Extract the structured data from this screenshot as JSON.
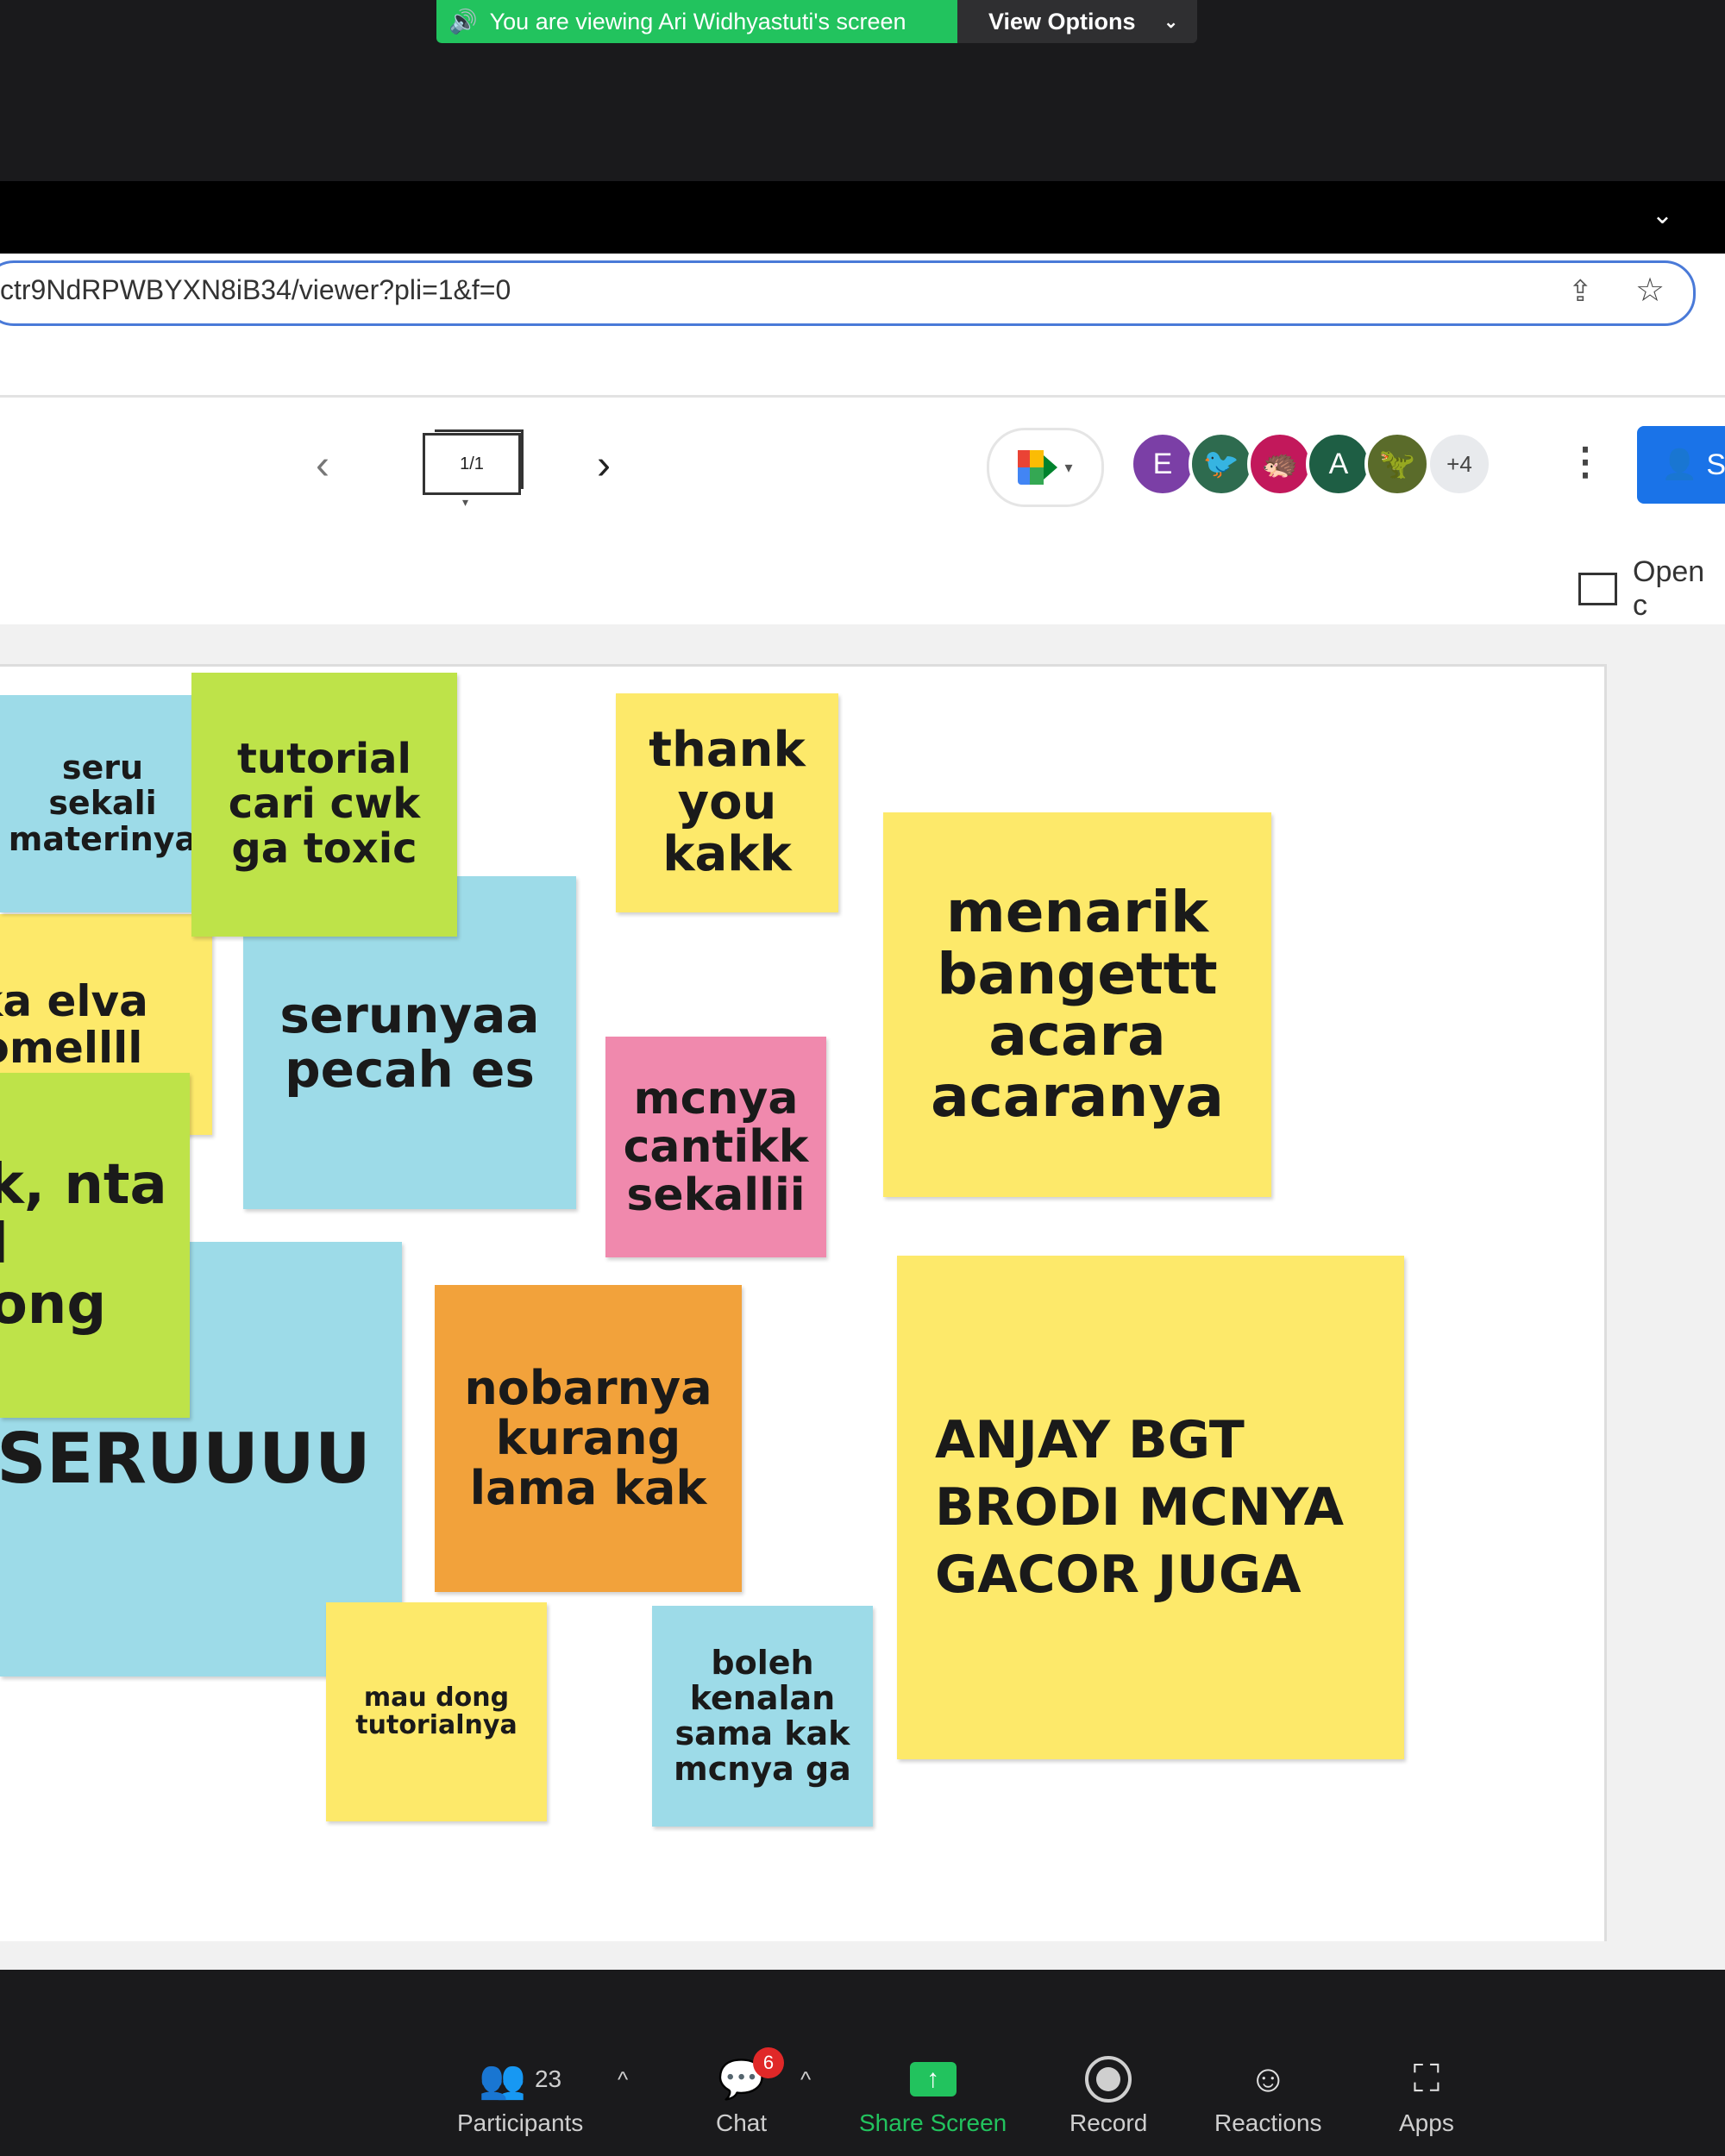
{
  "share_banner": {
    "viewing_text": "You are viewing Ari Widhyastuti's screen",
    "view_options_label": "View Options"
  },
  "browser": {
    "url": "ctr9NdRPWBYXN8iB34/viewer?pli=1&f=0"
  },
  "jamboard": {
    "page_indicator": "1/1",
    "avatars": [
      {
        "label": "E",
        "color": "#7b3fa6"
      },
      {
        "label": "",
        "color": "#2e6b4f"
      },
      {
        "label": "",
        "color": "#c2185b"
      },
      {
        "label": "A",
        "color": "#1e5e44"
      },
      {
        "label": "",
        "color": "#5a6b2a"
      }
    ],
    "more_count": "+4",
    "share_label": "S",
    "open_label": "Open c"
  },
  "notes": [
    {
      "id": "note-seru-sekali",
      "text": "seru sekali materinya"
    },
    {
      "id": "note-tutorial-cari-cwk",
      "text": "tutorial cari cwk ga toxic"
    },
    {
      "id": "note-elva",
      "text": "ka elva omellll"
    },
    {
      "id": "note-serunyaa",
      "text": "serunyaa pecah es"
    },
    {
      "id": "note-thank-you",
      "text": "thank you kakk"
    },
    {
      "id": "note-mcnya-cantikk",
      "text": "mcnya cantikk sekallii"
    },
    {
      "id": "note-menarik",
      "text": "menarik bangettt acara acaranya"
    },
    {
      "id": "note-minta-id",
      "text": "ak, nta id dong"
    },
    {
      "id": "note-seruuuu",
      "text": "SERUUUU"
    },
    {
      "id": "note-nobarnya",
      "text": "nobarnya kurang lama kak"
    },
    {
      "id": "note-anjay",
      "text": "ANJAY BGT BRODI MCNYA GACOR JUGA"
    },
    {
      "id": "note-mau-dong",
      "text": "mau dong tutorialnya"
    },
    {
      "id": "note-boleh-kenalan",
      "text": "boleh kenalan sama kak mcnya ga"
    }
  ],
  "toolbar": {
    "participants_label": "Participants",
    "participants_count": "23",
    "chat_label": "Chat",
    "chat_badge": "6",
    "share_screen_label": "Share Screen",
    "record_label": "Record",
    "reactions_label": "Reactions",
    "apps_label": "Apps"
  },
  "colors": {
    "share_green": "#22c35e",
    "note_yellow": "#fde96a",
    "note_lime": "#bee349",
    "note_blue": "#9ddbe8",
    "note_pink": "#f089ad",
    "note_orange": "#f2a23b"
  }
}
